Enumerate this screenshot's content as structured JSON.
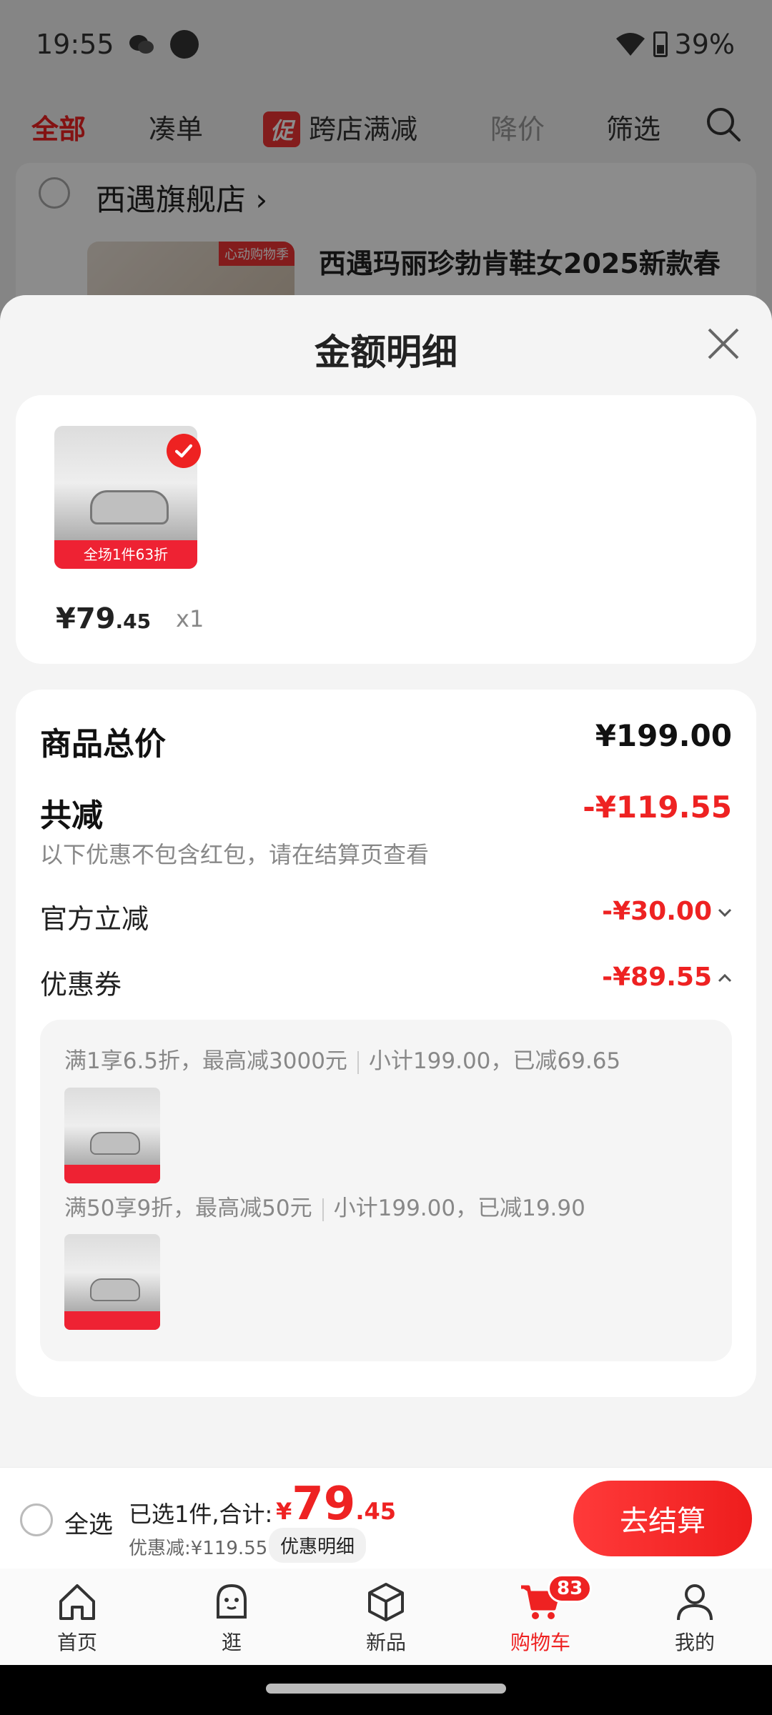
{
  "status_bar": {
    "time": "19:55",
    "battery": "39%"
  },
  "filter_tabs": [
    {
      "label": "全部"
    },
    {
      "label": "凑单"
    },
    {
      "label": "跨店满减",
      "chip": "促"
    },
    {
      "label": "降价"
    },
    {
      "label": "筛选"
    }
  ],
  "background_shop": {
    "name": "西遇旗舰店",
    "product_title": "西遇玛丽珍勃肯鞋女2025新款春",
    "thumb_tag": "心动购物季"
  },
  "sheet": {
    "title": "金额明细",
    "item": {
      "price_int": "¥79",
      "price_dec": ".45",
      "qty": "x1",
      "thumb_band": "全场1件63折"
    },
    "summary": {
      "total_label": "商品总价",
      "total_value": "¥199.00",
      "discount_label": "共减",
      "discount_value": "-¥119.55",
      "discount_note": "以下优惠不包含红包，请在结算页查看",
      "official_label": "官方立减",
      "official_value": "-¥30.00",
      "coupon_label": "优惠券",
      "coupon_value": "-¥89.55"
    },
    "coupon_rules": [
      {
        "rule": "满1享6.5折，最高减3000元",
        "detail": "小计199.00，已减69.65"
      },
      {
        "rule": "满50享9折，最高减50元",
        "detail": "小计199.00，已减19.90"
      }
    ]
  },
  "checkout": {
    "select_all": "全选",
    "selected_summary": "已选1件,合计:",
    "currency": "¥",
    "price_int": "79",
    "price_dec": ".45",
    "saved": "优惠减:¥119.55",
    "detail_button": "优惠明细",
    "checkout_button": "去结算"
  },
  "tab_bar": [
    {
      "label": "首页",
      "icon": "home-icon"
    },
    {
      "label": "逛",
      "icon": "browse-icon"
    },
    {
      "label": "新品",
      "icon": "new-products-icon"
    },
    {
      "label": "购物车",
      "icon": "cart-icon",
      "badge": "83"
    },
    {
      "label": "我的",
      "icon": "profile-icon"
    }
  ],
  "colors": {
    "accent": "#e22222",
    "sheet_bg": "#f4f4f4"
  }
}
